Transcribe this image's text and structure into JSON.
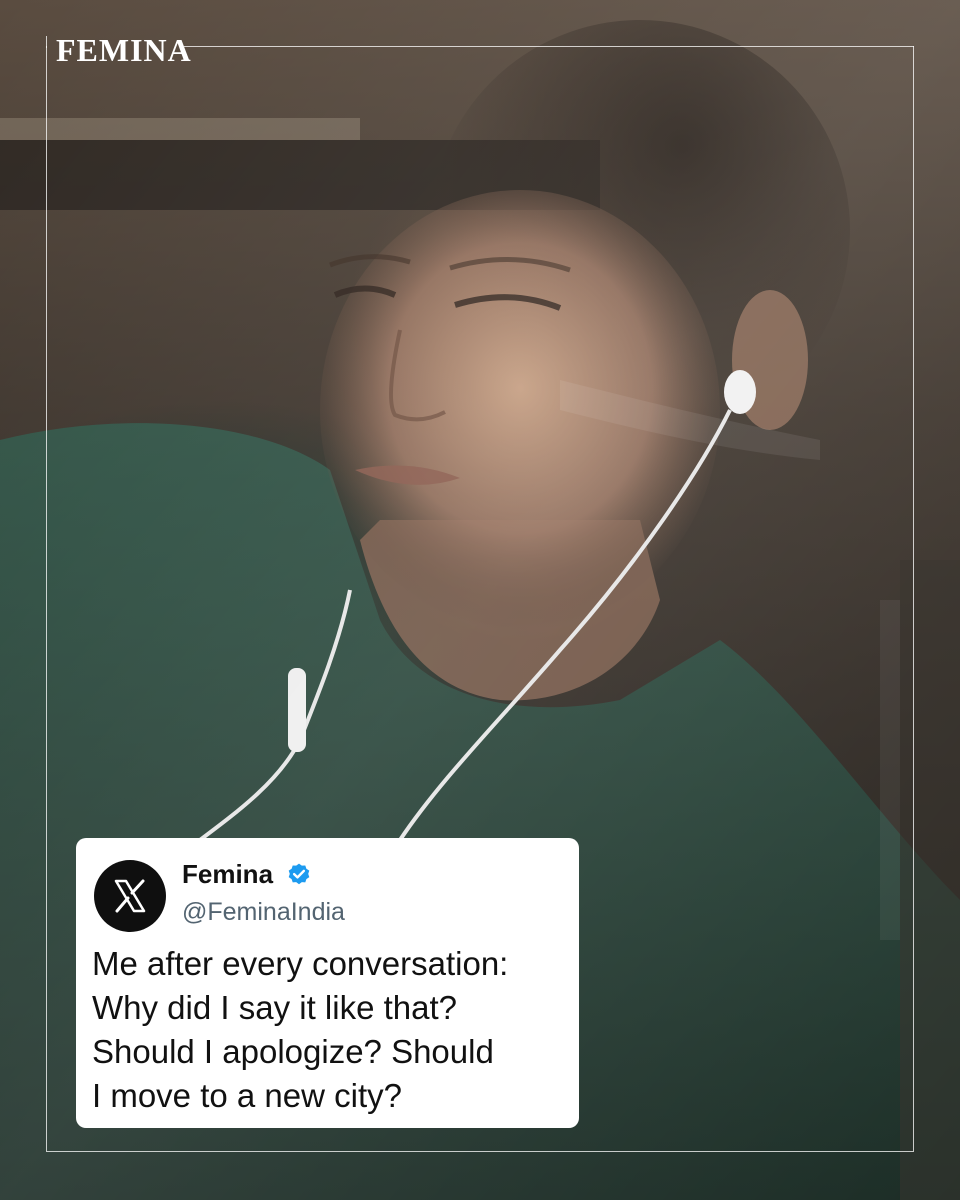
{
  "brand": {
    "name": "FEMINA"
  },
  "photo": {
    "subject": "person-with-earphones-behind-glass"
  },
  "tweet": {
    "platform_icon": "x-logo-icon",
    "author_name": "Femina",
    "verified_icon": "verified-badge-icon",
    "handle": "@FeminaIndia",
    "lines": [
      "Me after every conversation:",
      "Why did I say it like that?",
      "Should I apologize? Should",
      "I move to a new city?"
    ]
  },
  "colors": {
    "card_background": "#ffffff",
    "text_primary": "#111111",
    "text_secondary": "#536471",
    "verified_blue": "#1d9bf0",
    "x_logo_background": "#0f0f0f",
    "brand_text": "#ffffff"
  }
}
